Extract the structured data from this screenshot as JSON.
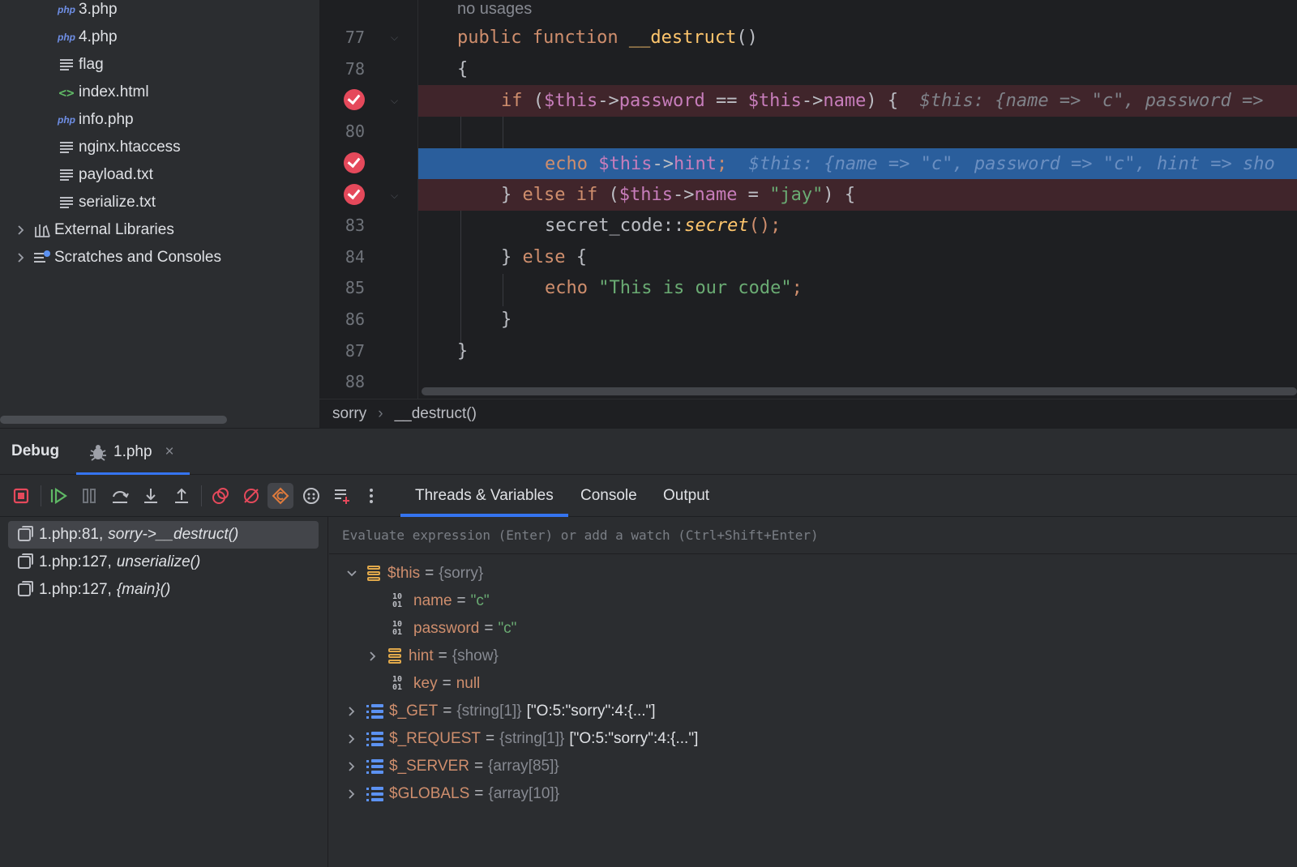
{
  "project": {
    "files": [
      {
        "label": "3.php",
        "icon": "php-file-icon",
        "kind": "php"
      },
      {
        "label": "4.php",
        "icon": "php-file-icon",
        "kind": "php"
      },
      {
        "label": "flag",
        "icon": "text-file-icon",
        "kind": "text"
      },
      {
        "label": "index.html",
        "icon": "html-file-icon",
        "kind": "html"
      },
      {
        "label": "info.php",
        "icon": "php-file-icon",
        "kind": "php"
      },
      {
        "label": "nginx.htaccess",
        "icon": "text-file-icon",
        "kind": "text"
      },
      {
        "label": "payload.txt",
        "icon": "text-file-icon",
        "kind": "text"
      },
      {
        "label": "serialize.txt",
        "icon": "text-file-icon",
        "kind": "text"
      }
    ],
    "external_libraries": "External Libraries",
    "scratches": "Scratches and Consoles",
    "php_badge": "php",
    "html_badge": "<>"
  },
  "editor": {
    "usages_hint": "no usages",
    "line_numbers": [
      "77",
      "78",
      "80",
      "83",
      "84",
      "85",
      "86",
      "87",
      "88"
    ],
    "lines": {
      "l77_kw": "public function ",
      "l77_fn": "__destruct",
      "l77_rest": "()",
      "l78": "{",
      "l79_kw": "if ",
      "l79_p1": "(",
      "l79_v1": "$this",
      "l79_op1": "->",
      "l79_f1": "password",
      "l79_eq": " == ",
      "l79_v2": "$this",
      "l79_op2": "->",
      "l79_f2": "name",
      "l79_end": ") {",
      "l79_inline": "$this: {name => \"c\", password =>",
      "l81_kw": "echo ",
      "l81_v": "$this",
      "l81_op": "->",
      "l81_f": "hint",
      "l81_end": ";",
      "l81_inline": "$this: {name => \"c\", password => \"c\", hint => sho",
      "l82_p1": "} ",
      "l82_kw": "else if ",
      "l82_p2": "(",
      "l82_v": "$this",
      "l82_op": "->",
      "l82_f": "name",
      "l82_eq": " = ",
      "l82_s": "\"jay\"",
      "l82_end": ") {",
      "l83_cls": "secret_code",
      "l83_op": "::",
      "l83_fn": "secret",
      "l83_end": "();",
      "l84_p": "} ",
      "l84_kw": "else",
      "l84_end": " {",
      "l85_kw": "echo ",
      "l85_s": "\"This is our code\"",
      "l85_end": ";",
      "l86": "}",
      "l87": "}"
    }
  },
  "breadcrumb": [
    "sorry",
    "__destruct()"
  ],
  "debug": {
    "title": "Debug",
    "tab_label": "1.php",
    "tab_close": "×",
    "tabs": [
      "Threads & Variables",
      "Console",
      "Output"
    ],
    "toolbar": [
      {
        "name": "stop-icon",
        "glyph": "■",
        "color": "#e5495b"
      },
      {
        "name": "resume-icon",
        "glyph": "▶",
        "color": "#5fb865"
      },
      {
        "name": "pause-icon",
        "glyph": "❚❚",
        "color": "#6f737a"
      },
      {
        "name": "step-over-icon",
        "glyph": "⤼",
        "color": "#bcbec4"
      },
      {
        "name": "step-into-icon",
        "glyph": "⤓",
        "color": "#bcbec4"
      },
      {
        "name": "step-out-icon",
        "glyph": "⤒",
        "color": "#bcbec4"
      },
      {
        "name": "view-breakpoints-icon",
        "glyph": "⬭",
        "color": "#e5495b"
      },
      {
        "name": "mute-breakpoints-icon",
        "glyph": "⊘",
        "color": "#e5495b"
      },
      {
        "name": "break-on-exception-icon",
        "glyph": "⊙",
        "color": "#e07b3c"
      },
      {
        "name": "evaluate-icon",
        "glyph": "☺",
        "color": "#bcbec4"
      },
      {
        "name": "add-watch-icon",
        "glyph": "≡",
        "color": "#bcbec4"
      },
      {
        "name": "more-icon",
        "glyph": "⋮",
        "color": "#bcbec4"
      }
    ],
    "frames": [
      {
        "loc": "1.php:81,",
        "fn": "sorry->__destruct()"
      },
      {
        "loc": "1.php:127,",
        "fn": "unserialize()"
      },
      {
        "loc": "1.php:127,",
        "fn": "{main}()"
      }
    ],
    "eval_placeholder": "Evaluate expression (Enter) or add a watch (Ctrl+Shift+Enter)",
    "variables": {
      "this": {
        "name": "$this",
        "eq": "=",
        "type": "{sorry}"
      },
      "name": {
        "name": "name",
        "eq": "=",
        "value": "\"c\""
      },
      "password": {
        "name": "password",
        "eq": "=",
        "value": "\"c\""
      },
      "hint": {
        "name": "hint",
        "eq": "=",
        "type": "{show}"
      },
      "key": {
        "name": "key",
        "eq": "=",
        "value": "null"
      },
      "get": {
        "name": "$_GET",
        "eq": "=",
        "type": "{string[1]}",
        "value": "[\"O:5:\"sorry\":4:{...\"]"
      },
      "request": {
        "name": "$_REQUEST",
        "eq": "=",
        "type": "{string[1]}",
        "value": "[\"O:5:\"sorry\":4:{...\"]"
      },
      "server": {
        "name": "$_SERVER",
        "eq": "=",
        "type": "{array[85]}"
      },
      "globals": {
        "name": "$GLOBALS",
        "eq": "=",
        "type": "{array[10]}"
      }
    }
  }
}
